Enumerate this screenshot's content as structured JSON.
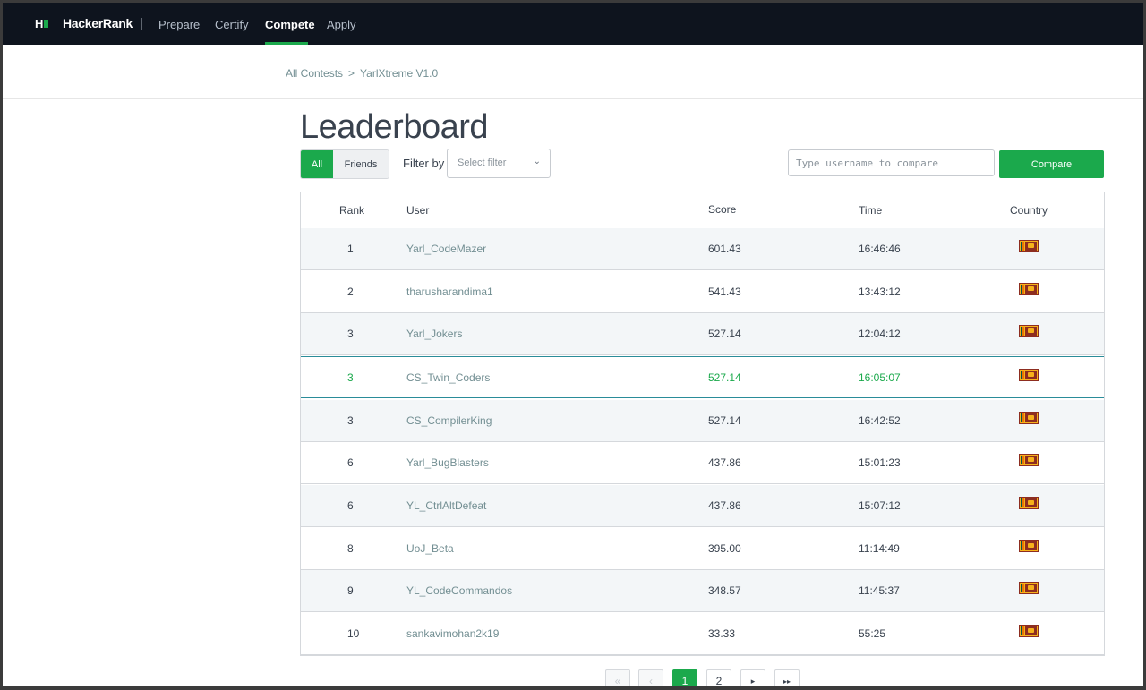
{
  "nav": {
    "logo_mark": "H",
    "brand": "HackerRank",
    "items": [
      {
        "label": "Prepare",
        "active": false
      },
      {
        "label": "Certify",
        "active": false
      },
      {
        "label": "Compete",
        "active": true
      },
      {
        "label": "Apply",
        "active": false
      }
    ]
  },
  "breadcrumb": {
    "items": [
      "All Contests",
      "YarlXtreme V1.0"
    ]
  },
  "page": {
    "title": "Leaderboard"
  },
  "controls": {
    "tab_all": "All",
    "tab_friends": "Friends",
    "filter_label": "Filter by",
    "filter_placeholder": "Select filter",
    "compare_placeholder": "Type username to compare",
    "compare_button": "Compare"
  },
  "table": {
    "headers": [
      "Rank",
      "User",
      "Score",
      "Time",
      "Country"
    ],
    "rows": [
      {
        "rank": "1",
        "user": "Yarl_CodeMazer",
        "score": "601.43",
        "time": "16:46:46",
        "country_icon": "sri-lanka-flag-icon"
      },
      {
        "rank": "2",
        "user": "tharusharandima1",
        "score": "541.43",
        "time": "13:43:12",
        "country_icon": "sri-lanka-flag-icon"
      },
      {
        "rank": "3",
        "user": "Yarl_Jokers",
        "score": "527.14",
        "time": "12:04:12",
        "country_icon": "sri-lanka-flag-icon"
      },
      {
        "rank": "3",
        "user": "CS_Twin_Coders",
        "score": "527.14",
        "time": "16:05:07",
        "country_icon": "sri-lanka-flag-icon",
        "highlight": true
      },
      {
        "rank": "3",
        "user": "CS_CompilerKing",
        "score": "527.14",
        "time": "16:42:52",
        "country_icon": "sri-lanka-flag-icon"
      },
      {
        "rank": "6",
        "user": "Yarl_BugBlasters",
        "score": "437.86",
        "time": "15:01:23",
        "country_icon": "sri-lanka-flag-icon"
      },
      {
        "rank": "6",
        "user": "YL_CtrlAltDefeat",
        "score": "437.86",
        "time": "15:07:12",
        "country_icon": "sri-lanka-flag-icon"
      },
      {
        "rank": "8",
        "user": "UoJ_Beta",
        "score": "395.00",
        "time": "11:14:49",
        "country_icon": "sri-lanka-flag-icon"
      },
      {
        "rank": "9",
        "user": "YL_CodeCommandos",
        "score": "348.57",
        "time": "11:45:37",
        "country_icon": "sri-lanka-flag-icon"
      },
      {
        "rank": "10",
        "user": "sankavimohan2k19",
        "score": "33.33",
        "time": "55:25",
        "country_icon": "sri-lanka-flag-icon"
      }
    ]
  },
  "pagination": {
    "first": "«",
    "prev": "‹",
    "pages": [
      "1",
      "2"
    ],
    "current": "1",
    "next": "▸",
    "last": "▸▸"
  },
  "colors": {
    "accent": "#1ba94c",
    "nav_bg": "#0e141e",
    "highlight_border": "#2a8c99"
  }
}
